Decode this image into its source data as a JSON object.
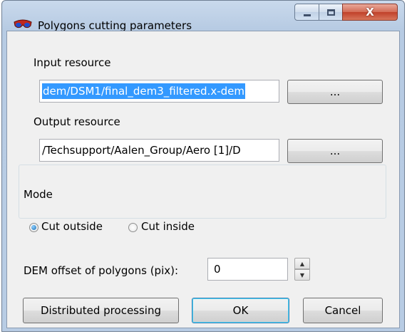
{
  "window": {
    "title": "Polygons cutting parameters",
    "icons": {
      "app": "3d-glasses-icon",
      "minimize": "minimize-icon",
      "maximize": "maximize-icon",
      "close": "close-icon"
    },
    "close_glyph": "X"
  },
  "input_resource": {
    "label": "Input resource",
    "value": "dem/DSM1/final_dem3_filtered.x-dem",
    "value_selected": true,
    "browse_label": "..."
  },
  "output_resource": {
    "label": "Output resource",
    "value": "/Techsupport/Aalen_Group/Aero [1]/D",
    "browse_label": "..."
  },
  "mode": {
    "label": "Mode",
    "options": [
      {
        "label": "Cut outside",
        "checked": true
      },
      {
        "label": "Cut inside",
        "checked": false
      }
    ]
  },
  "dem_offset": {
    "label": "DEM offset of polygons (pix):",
    "value": "0"
  },
  "buttons": {
    "distributed": "Distributed processing",
    "ok": "OK",
    "cancel": "Cancel"
  },
  "colors": {
    "selection": "#3399ff",
    "dialog_bg": "#f0f0f0",
    "default_button_border": "#3c7fb1"
  }
}
